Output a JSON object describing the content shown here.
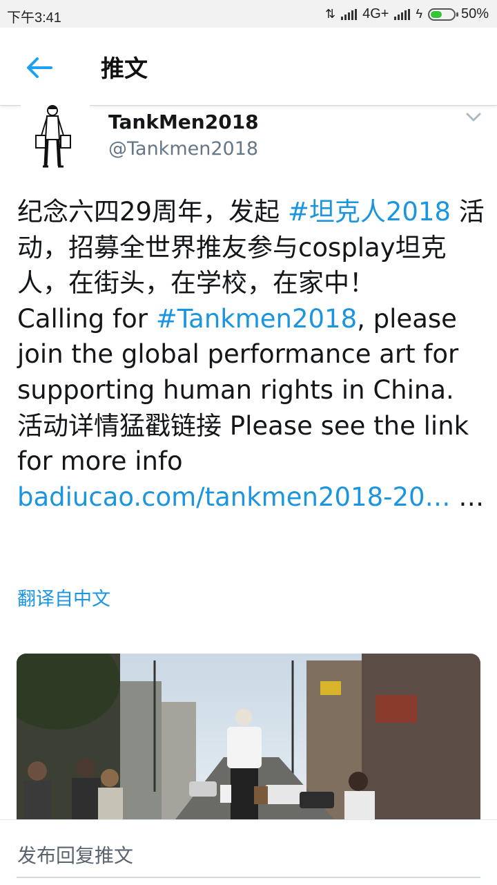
{
  "status_bar": {
    "time": "下午3:41",
    "network": "4G+",
    "battery": "50%",
    "battery_level": 0.5
  },
  "header": {
    "title": "推文",
    "back_icon": "arrow-left-icon"
  },
  "tweet": {
    "display_name": "TankMen2018",
    "handle": "@Tankmen2018",
    "text_segments": [
      {
        "text": "纪念六四29周年，发起 ",
        "link": false
      },
      {
        "text": "#坦克人2018",
        "link": true
      },
      {
        "text": " 活动，招募全世界推友参与cosplay坦克人，在街头，在学校，在家中！\nCalling for ",
        "link": false
      },
      {
        "text": "#Tankmen2018",
        "link": true
      },
      {
        "text": ", please join the global performance art for supporting human rights in China. 活动详情猛戳链接 Please see the link for more info  ",
        "link": false
      },
      {
        "text": "badiucao.com/tankmen2018-20…",
        "link": true
      },
      {
        "text": " …",
        "link": false
      }
    ],
    "translate_label": "翻译自中文",
    "more_icon": "chevron-down-icon"
  },
  "reply": {
    "placeholder": "发布回复推文"
  },
  "colors": {
    "link": "#1b95e0",
    "back_arrow": "#1da1f2"
  }
}
